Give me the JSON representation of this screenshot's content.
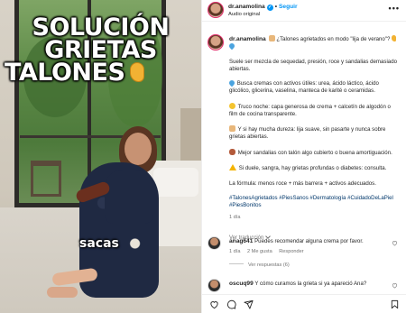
{
  "post": {
    "username": "dr.anamolina",
    "follow_label": "Seguir",
    "audio_label": "Audio original",
    "more_label": "•••"
  },
  "media": {
    "overlay_title": [
      "SOLUCIÓN",
      "GRIETAS",
      "TALONES"
    ],
    "overlay_caption": "sacas"
  },
  "caption": {
    "username": "dr.anamolina",
    "intro": "¿Talones agrietados en modo \"lija de verano\"? ",
    "p1": "Suele ser mezcla de sequedad, presión, roce y sandalias demasiado abiertas.",
    "p2": "Busca cremas con activos útiles: urea, ácido láctico, ácido glicólico, glicerina, vaselina, manteca de karité o ceramidas.",
    "p3": "Truco noche: capa generosa de crema + calcetín de algodón o film de cocina transparente.",
    "p4": "Y si hay mucha dureza: lija suave, sin pasarte y nunca sobre grietas abiertas.",
    "p5": "Mejor sandalias con talón algo cubierto o buena amortiguación.",
    "p6": "Si duele, sangra, hay grietas profundas o diabetes: consulta.",
    "p7": "La fórmula: menos roce + más barrera + activos adecuados.",
    "hashtags": "#TalonesAgrietados #PiesSanos #Dermatología #CuidadoDeLaPiel #PiesBonitos",
    "time": "1 día"
  },
  "translation": {
    "label": "Ver traducción"
  },
  "comments": [
    {
      "username": "anag641",
      "text": "Puedes recomendar alguna crema por favor.",
      "time": "1 día",
      "likes": "2 Me gusta",
      "reply_label": "Responder",
      "replies_label": "Ver respuestas (6)"
    },
    {
      "username": "oscuq99",
      "text": "Y cómo curamos la grieta si ya apareció Ana?"
    }
  ],
  "icons": {
    "like": "heart-icon",
    "comment": "comment-icon",
    "share": "share-icon",
    "save": "bookmark-icon"
  },
  "colors": {
    "link": "#00376b",
    "follow": "#0095f6",
    "muted": "#737373"
  }
}
